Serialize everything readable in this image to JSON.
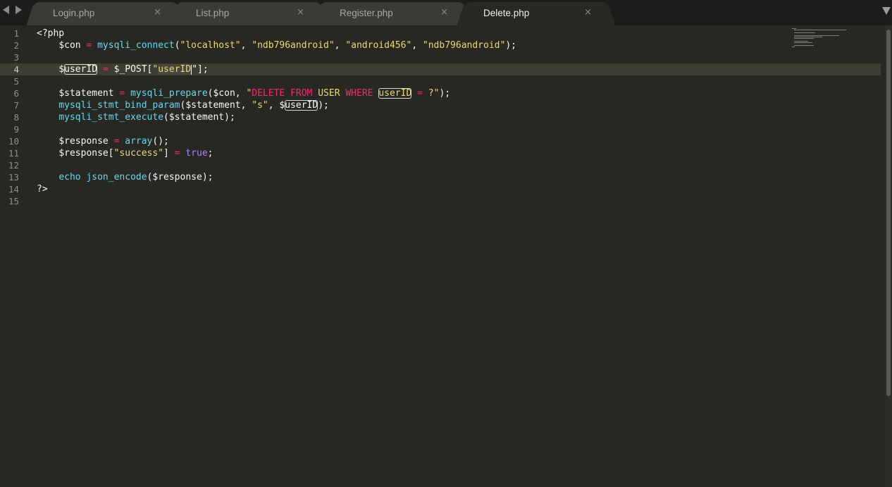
{
  "tabs": [
    {
      "label": "Login.php",
      "close": "×",
      "active": false
    },
    {
      "label": "List.php",
      "close": "×",
      "active": false
    },
    {
      "label": "Register.php",
      "close": "×",
      "active": false
    },
    {
      "label": "Delete.php",
      "close": "×",
      "active": true
    }
  ],
  "current_line": 4,
  "gutter": [
    "1",
    "2",
    "3",
    "4",
    "5",
    "6",
    "7",
    "8",
    "9",
    "10",
    "11",
    "12",
    "13",
    "14",
    "15"
  ],
  "code": {
    "l1": "<?php",
    "l2": {
      "var": "$con",
      "eq": "=",
      "fn": "mysqli_connect",
      "a1": "\"localhost\"",
      "a2": "\"ndb796android\"",
      "a3": "\"android456\"",
      "a4": "\"ndb796android\""
    },
    "l4": {
      "dollar": "$",
      "name": "userID",
      "eq": "=",
      "post": "$_POST[",
      "key": "userID",
      "end": "\"];"
    },
    "l6": {
      "var": "$statement",
      "eq": "=",
      "fn": "mysqli_prepare",
      "arg": "($con, ",
      "q1": "\"",
      "delete": "DELETE",
      "from": "FROM",
      "user": "USER",
      "where": "WHERE",
      "col": "userID",
      "qeq": "=",
      "q2": "?\"",
      "end": ");"
    },
    "l7": {
      "fn": "mysqli_stmt_bind_param",
      "arg": "($statement, ",
      "s": "\"s\"",
      "dollar": ", $",
      "name": "userID",
      "end": ");"
    },
    "l8": {
      "fn": "mysqli_stmt_execute",
      "arg": "($statement);"
    },
    "l10": {
      "var": "$response",
      "eq": "=",
      "fn": "array",
      "end": "();"
    },
    "l11": {
      "var": "$response[",
      "key": "\"success\"",
      "close": "]",
      "eq": "=",
      "val": "true",
      "end": ";"
    },
    "l13": {
      "kw": "echo",
      "fn": "json_encode",
      "arg": "($response);"
    },
    "l14": "?>"
  }
}
